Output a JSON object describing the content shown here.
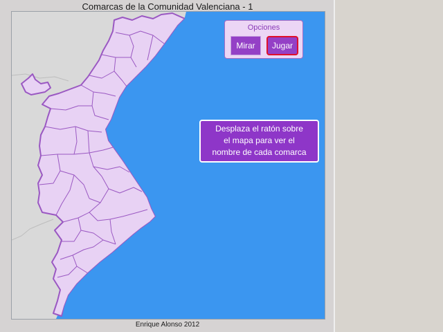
{
  "title": "Comarcas de la Comunidad Valenciana - 1",
  "options": {
    "heading": "Opciones",
    "view_label": "Mirar",
    "play_label": "Jugar"
  },
  "instructions": {
    "line1": "Desplaza el ratón sobre",
    "line2": "el mapa para ver el",
    "line3": "nombre de cada comarca"
  },
  "footer": "Enrique Alonso 2012",
  "colors": {
    "sea": "#3b96f0",
    "land_region": "#e8d2f4",
    "land_border": "#9a58c2",
    "neighbor_land": "#d9d9d9",
    "button": "#9440c6",
    "active_outline": "#e0102a"
  }
}
